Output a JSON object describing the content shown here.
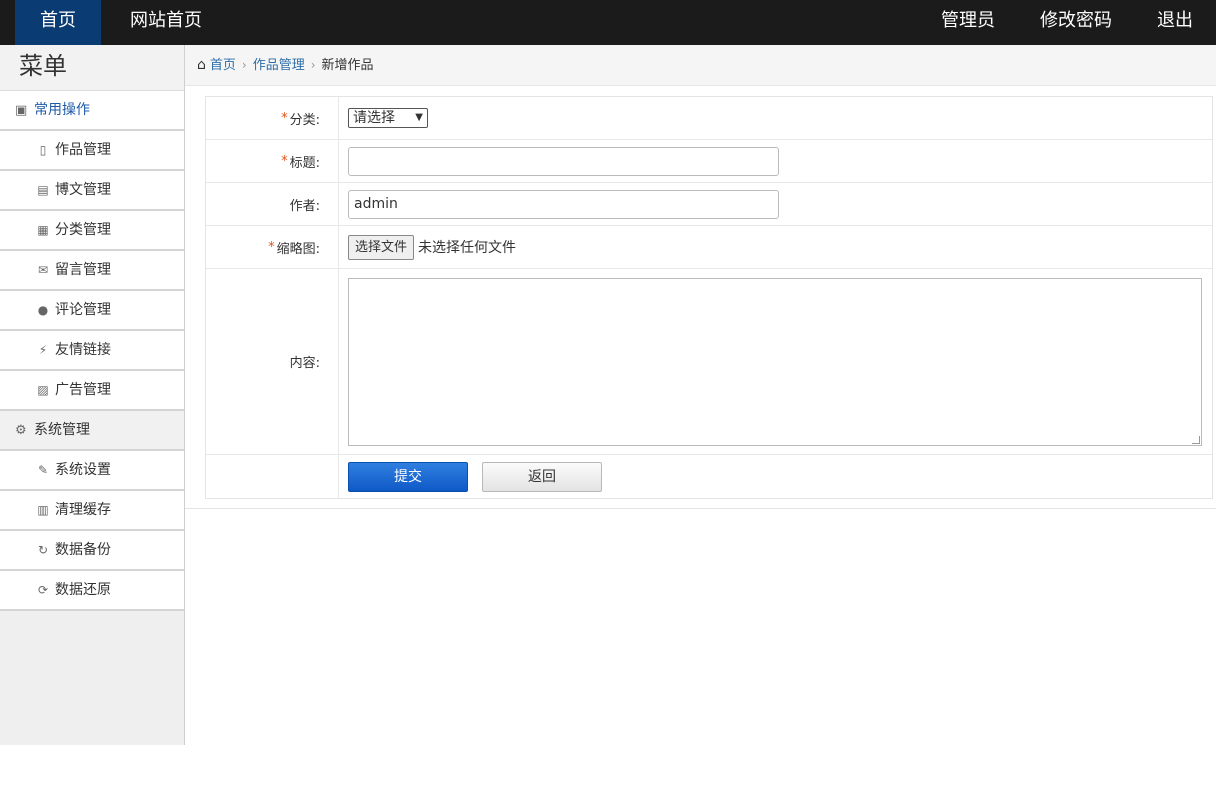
{
  "topbar": {
    "home": "首页",
    "site_home": "网站首页",
    "admin": "管理员",
    "change_password": "修改密码",
    "logout": "退出"
  },
  "sidebar": {
    "title": "菜单",
    "groups": [
      {
        "label": "常用操作",
        "icon": "address-book-icon",
        "items": [
          {
            "label": "作品管理",
            "icon": "file-icon"
          },
          {
            "label": "博文管理",
            "icon": "document-icon"
          },
          {
            "label": "分类管理",
            "icon": "books-icon"
          },
          {
            "label": "留言管理",
            "icon": "envelope-icon"
          },
          {
            "label": "评论管理",
            "icon": "comment-icon"
          },
          {
            "label": "友情链接",
            "icon": "plug-icon"
          },
          {
            "label": "广告管理",
            "icon": "image-icon"
          }
        ]
      },
      {
        "label": "系统管理",
        "icon": "gear-icon",
        "items": [
          {
            "label": "系统设置",
            "icon": "wrench-icon"
          },
          {
            "label": "清理缓存",
            "icon": "trash-icon"
          },
          {
            "label": "数据备份",
            "icon": "refresh-icon"
          },
          {
            "label": "数据还原",
            "icon": "sync-icon"
          }
        ]
      }
    ]
  },
  "breadcrumb": {
    "home": "首页",
    "section": "作品管理",
    "current": "新增作品"
  },
  "form": {
    "category_label": "分类:",
    "category_value": "请选择",
    "title_label": "标题:",
    "title_value": "",
    "author_label": "作者:",
    "author_value": "admin",
    "thumb_label": "缩略图:",
    "file_button": "选择文件",
    "file_status": "未选择任何文件",
    "content_label": "内容:",
    "submit": "提交",
    "back": "返回"
  },
  "colors": {
    "topbar_bg": "#1b1b1b",
    "topbar_active": "#0a3b73",
    "link": "#2d6ea8",
    "required": "#e4531c",
    "submit_bg": "#1565d0"
  }
}
